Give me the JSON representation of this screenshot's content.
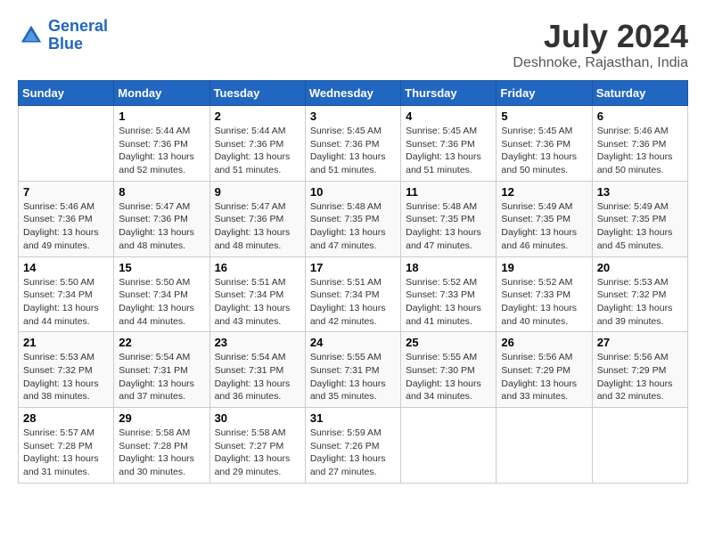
{
  "header": {
    "logo_line1": "General",
    "logo_line2": "Blue",
    "month": "July 2024",
    "location": "Deshnoke, Rajasthan, India"
  },
  "days_of_week": [
    "Sunday",
    "Monday",
    "Tuesday",
    "Wednesday",
    "Thursday",
    "Friday",
    "Saturday"
  ],
  "weeks": [
    [
      {
        "day": "",
        "info": ""
      },
      {
        "day": "1",
        "info": "Sunrise: 5:44 AM\nSunset: 7:36 PM\nDaylight: 13 hours\nand 52 minutes."
      },
      {
        "day": "2",
        "info": "Sunrise: 5:44 AM\nSunset: 7:36 PM\nDaylight: 13 hours\nand 51 minutes."
      },
      {
        "day": "3",
        "info": "Sunrise: 5:45 AM\nSunset: 7:36 PM\nDaylight: 13 hours\nand 51 minutes."
      },
      {
        "day": "4",
        "info": "Sunrise: 5:45 AM\nSunset: 7:36 PM\nDaylight: 13 hours\nand 51 minutes."
      },
      {
        "day": "5",
        "info": "Sunrise: 5:45 AM\nSunset: 7:36 PM\nDaylight: 13 hours\nand 50 minutes."
      },
      {
        "day": "6",
        "info": "Sunrise: 5:46 AM\nSunset: 7:36 PM\nDaylight: 13 hours\nand 50 minutes."
      }
    ],
    [
      {
        "day": "7",
        "info": "Sunrise: 5:46 AM\nSunset: 7:36 PM\nDaylight: 13 hours\nand 49 minutes."
      },
      {
        "day": "8",
        "info": "Sunrise: 5:47 AM\nSunset: 7:36 PM\nDaylight: 13 hours\nand 48 minutes."
      },
      {
        "day": "9",
        "info": "Sunrise: 5:47 AM\nSunset: 7:36 PM\nDaylight: 13 hours\nand 48 minutes."
      },
      {
        "day": "10",
        "info": "Sunrise: 5:48 AM\nSunset: 7:35 PM\nDaylight: 13 hours\nand 47 minutes."
      },
      {
        "day": "11",
        "info": "Sunrise: 5:48 AM\nSunset: 7:35 PM\nDaylight: 13 hours\nand 47 minutes."
      },
      {
        "day": "12",
        "info": "Sunrise: 5:49 AM\nSunset: 7:35 PM\nDaylight: 13 hours\nand 46 minutes."
      },
      {
        "day": "13",
        "info": "Sunrise: 5:49 AM\nSunset: 7:35 PM\nDaylight: 13 hours\nand 45 minutes."
      }
    ],
    [
      {
        "day": "14",
        "info": "Sunrise: 5:50 AM\nSunset: 7:34 PM\nDaylight: 13 hours\nand 44 minutes."
      },
      {
        "day": "15",
        "info": "Sunrise: 5:50 AM\nSunset: 7:34 PM\nDaylight: 13 hours\nand 44 minutes."
      },
      {
        "day": "16",
        "info": "Sunrise: 5:51 AM\nSunset: 7:34 PM\nDaylight: 13 hours\nand 43 minutes."
      },
      {
        "day": "17",
        "info": "Sunrise: 5:51 AM\nSunset: 7:34 PM\nDaylight: 13 hours\nand 42 minutes."
      },
      {
        "day": "18",
        "info": "Sunrise: 5:52 AM\nSunset: 7:33 PM\nDaylight: 13 hours\nand 41 minutes."
      },
      {
        "day": "19",
        "info": "Sunrise: 5:52 AM\nSunset: 7:33 PM\nDaylight: 13 hours\nand 40 minutes."
      },
      {
        "day": "20",
        "info": "Sunrise: 5:53 AM\nSunset: 7:32 PM\nDaylight: 13 hours\nand 39 minutes."
      }
    ],
    [
      {
        "day": "21",
        "info": "Sunrise: 5:53 AM\nSunset: 7:32 PM\nDaylight: 13 hours\nand 38 minutes."
      },
      {
        "day": "22",
        "info": "Sunrise: 5:54 AM\nSunset: 7:31 PM\nDaylight: 13 hours\nand 37 minutes."
      },
      {
        "day": "23",
        "info": "Sunrise: 5:54 AM\nSunset: 7:31 PM\nDaylight: 13 hours\nand 36 minutes."
      },
      {
        "day": "24",
        "info": "Sunrise: 5:55 AM\nSunset: 7:31 PM\nDaylight: 13 hours\nand 35 minutes."
      },
      {
        "day": "25",
        "info": "Sunrise: 5:55 AM\nSunset: 7:30 PM\nDaylight: 13 hours\nand 34 minutes."
      },
      {
        "day": "26",
        "info": "Sunrise: 5:56 AM\nSunset: 7:29 PM\nDaylight: 13 hours\nand 33 minutes."
      },
      {
        "day": "27",
        "info": "Sunrise: 5:56 AM\nSunset: 7:29 PM\nDaylight: 13 hours\nand 32 minutes."
      }
    ],
    [
      {
        "day": "28",
        "info": "Sunrise: 5:57 AM\nSunset: 7:28 PM\nDaylight: 13 hours\nand 31 minutes."
      },
      {
        "day": "29",
        "info": "Sunrise: 5:58 AM\nSunset: 7:28 PM\nDaylight: 13 hours\nand 30 minutes."
      },
      {
        "day": "30",
        "info": "Sunrise: 5:58 AM\nSunset: 7:27 PM\nDaylight: 13 hours\nand 29 minutes."
      },
      {
        "day": "31",
        "info": "Sunrise: 5:59 AM\nSunset: 7:26 PM\nDaylight: 13 hours\nand 27 minutes."
      },
      {
        "day": "",
        "info": ""
      },
      {
        "day": "",
        "info": ""
      },
      {
        "day": "",
        "info": ""
      }
    ]
  ]
}
